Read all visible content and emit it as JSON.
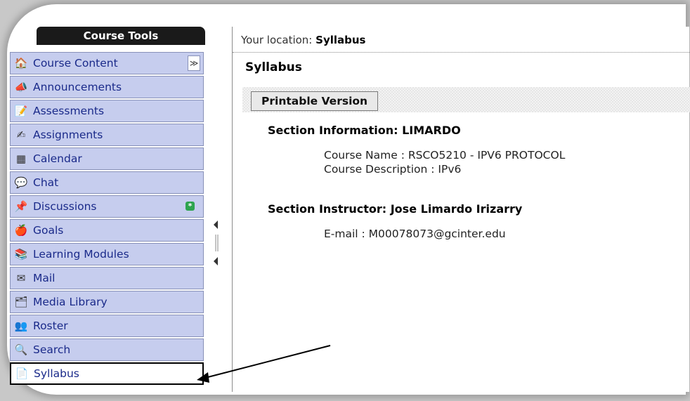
{
  "sidebar": {
    "header": "Course Tools",
    "items": [
      {
        "label": "Course Content",
        "icon": "house-icon"
      },
      {
        "label": "Announcements",
        "icon": "megaphone-icon"
      },
      {
        "label": "Assessments",
        "icon": "quiz-icon"
      },
      {
        "label": "Assignments",
        "icon": "assignment-icon"
      },
      {
        "label": "Calendar",
        "icon": "calendar-icon"
      },
      {
        "label": "Chat",
        "icon": "chat-bubble-icon"
      },
      {
        "label": "Discussions",
        "icon": "pin-icon"
      },
      {
        "label": "Goals",
        "icon": "goals-icon"
      },
      {
        "label": "Learning Modules",
        "icon": "modules-icon"
      },
      {
        "label": "Mail",
        "icon": "envelope-icon"
      },
      {
        "label": "Media Library",
        "icon": "media-library-icon"
      },
      {
        "label": "Roster",
        "icon": "people-icon"
      },
      {
        "label": "Search",
        "icon": "magnifier-icon"
      },
      {
        "label": "Syllabus",
        "icon": "syllabus-icon"
      }
    ],
    "selected": "Syllabus",
    "collapse_glyph": "≫"
  },
  "main": {
    "location_prefix": "Your location:",
    "location_value": "Syllabus",
    "page_title": "Syllabus",
    "printable_button": "Printable Version",
    "section_info_heading": "Section Information: LIMARDO",
    "course_name_line": "Course Name : RSCO5210 - IPV6 PROTOCOL",
    "course_description_line": "Course Description : IPv6",
    "instructor_heading": "Section Instructor: Jose Limardo Irizarry",
    "email_line": "E-mail : M00078073@gcinter.edu"
  },
  "colors": {
    "sidebar_item_bg": "#c6cdee",
    "sidebar_text": "#1a2a8a",
    "header_bg": "#1a1a1a",
    "new_badge": "#2ea44f"
  }
}
